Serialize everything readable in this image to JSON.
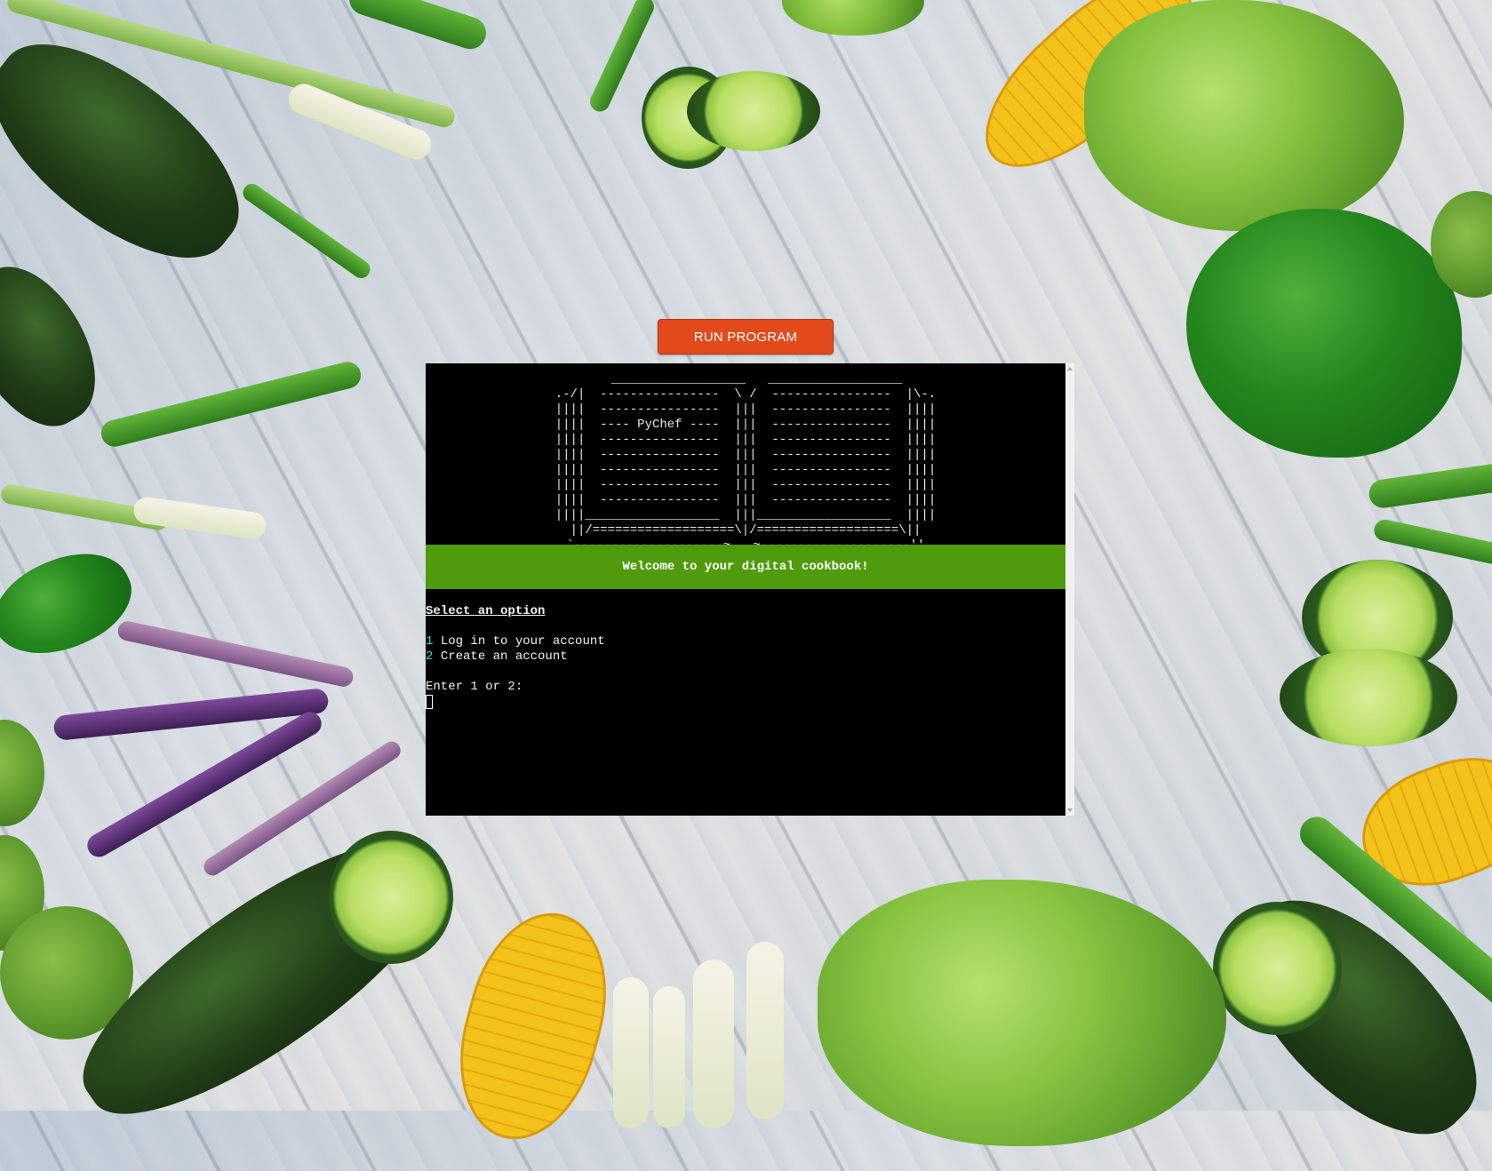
{
  "toolbar": {
    "run_label": "RUN PROGRAM"
  },
  "terminal": {
    "ascii_art": {
      "lines": [
        "   __________________   __________________",
        ".-/|  ----------------  \\ /  ----------------  |\\-.",
        "||||  ----------------  |||  ----------------  ||||",
        "||||  ---- PyChef ----  |||  ----------------  ||||",
        "||||  ----------------  |||  ----------------  ||||",
        "||||  ----------------  |||  ----------------  ||||",
        "||||  ----------------  |||  ----------------  ||||",
        "||||  ----------------  |||  ----------------  ||||",
        "||||  ----------------  |||  ----------------  ||||",
        "||||__________________  |||__________________  ||||",
        "||/===================\\|/===================\\||",
        "`--------------------~___~--------------------''"
      ]
    },
    "banner": "Welcome to your digital cookbook!",
    "heading": "Select an option",
    "options": [
      {
        "number": "1",
        "label": "Log in to your account"
      },
      {
        "number": "2",
        "label": "Create an account"
      }
    ],
    "prompt": "Enter 1 or 2:"
  },
  "colors": {
    "run_button": "#e24a1b",
    "banner_bg": "#4f9b0b",
    "option_number": "#35d7cf",
    "terminal_bg": "#000000"
  }
}
